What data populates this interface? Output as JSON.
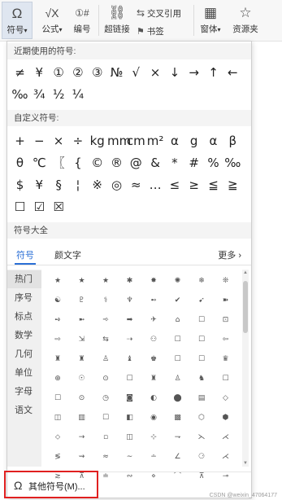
{
  "ribbon": {
    "symbol": {
      "icon": "Ω",
      "label": "符号",
      "arrow": "▾"
    },
    "formula": {
      "icon": "√X",
      "label": "公式",
      "arrow": "▾"
    },
    "numbering": {
      "icon": "①#",
      "label": "编号"
    },
    "hyperlink": {
      "icon": "⛓",
      "label": "超链接"
    },
    "crossref": {
      "icon": "⇆",
      "label": "交叉引用"
    },
    "bookmark": {
      "icon": "⚑",
      "label": "书签"
    },
    "window": {
      "icon": "▦",
      "label": "窗体",
      "arrow": "▾"
    },
    "resource": {
      "icon": "☆",
      "label": "资源夹"
    }
  },
  "recent": {
    "title": "近期使用的符号:",
    "symbols": [
      "≠",
      "¥",
      "①",
      "②",
      "③",
      "№",
      "√",
      "×",
      "↓",
      "→",
      "↑",
      "←",
      "‰",
      "¾",
      "½",
      "¼"
    ]
  },
  "custom": {
    "title": "自定义符号:",
    "symbols": [
      "+",
      "−",
      "×",
      "÷",
      "kg",
      "mm",
      "cm",
      "m²",
      "α",
      "g",
      "α",
      "β",
      "θ",
      "℃",
      "〖",
      "{",
      "©",
      "®",
      "@",
      "&",
      "*",
      "#",
      "%",
      "‰",
      "$",
      "¥",
      "§",
      "¦",
      "※",
      "◎",
      "≈",
      "…",
      "≤",
      "≥",
      "≦",
      "≧",
      "☐",
      "☑",
      "☒"
    ]
  },
  "all": {
    "title": "符号大全",
    "tabs": [
      "符号",
      "颜文字"
    ],
    "more": "更多",
    "more_arrow": "›",
    "categories": [
      "热门",
      "序号",
      "标点",
      "数学",
      "几何",
      "单位",
      "字母",
      "语文"
    ],
    "symbols": [
      "★",
      "★",
      "★",
      "✱",
      "✸",
      "✺",
      "❄",
      "❊",
      "☯",
      "♇",
      "⚕",
      "♆",
      "➻",
      "✔",
      "➹",
      "➽",
      "➺",
      "➼",
      "➾",
      "➡",
      "✈",
      "⌂",
      "☐",
      "⊡",
      "⇨",
      "⇲",
      "⇆",
      "⇢",
      "⚇",
      "☐",
      "☐",
      "⇦",
      "♜",
      "♜",
      "♙",
      "♝",
      "♚",
      "☐",
      "☐",
      "♛",
      "⊕",
      "☉",
      "⊙",
      "☐",
      "♜",
      "♙",
      "♞",
      "☐",
      "☐",
      "⊙",
      "◷",
      "◙",
      "◐",
      "⬤",
      "▤",
      "◇",
      "◫",
      "▥",
      "☐",
      "◧",
      "◉",
      "▩",
      "⬡",
      "⬢",
      "⬦",
      "→",
      "▫",
      "◫",
      "⊹",
      "⇁",
      "⋋",
      "⋌",
      "≶",
      "⇝",
      "≈",
      "∼",
      "∸",
      "∠",
      "⚆",
      "⋌",
      "≳",
      "⊼",
      "≐",
      "∾",
      "⋄",
      "⌒",
      "⊼",
      "⊸"
    ]
  },
  "other": {
    "icon": "Ω",
    "label": "其他符号(M)..."
  },
  "watermark": "CSDN @weixin_47064177"
}
